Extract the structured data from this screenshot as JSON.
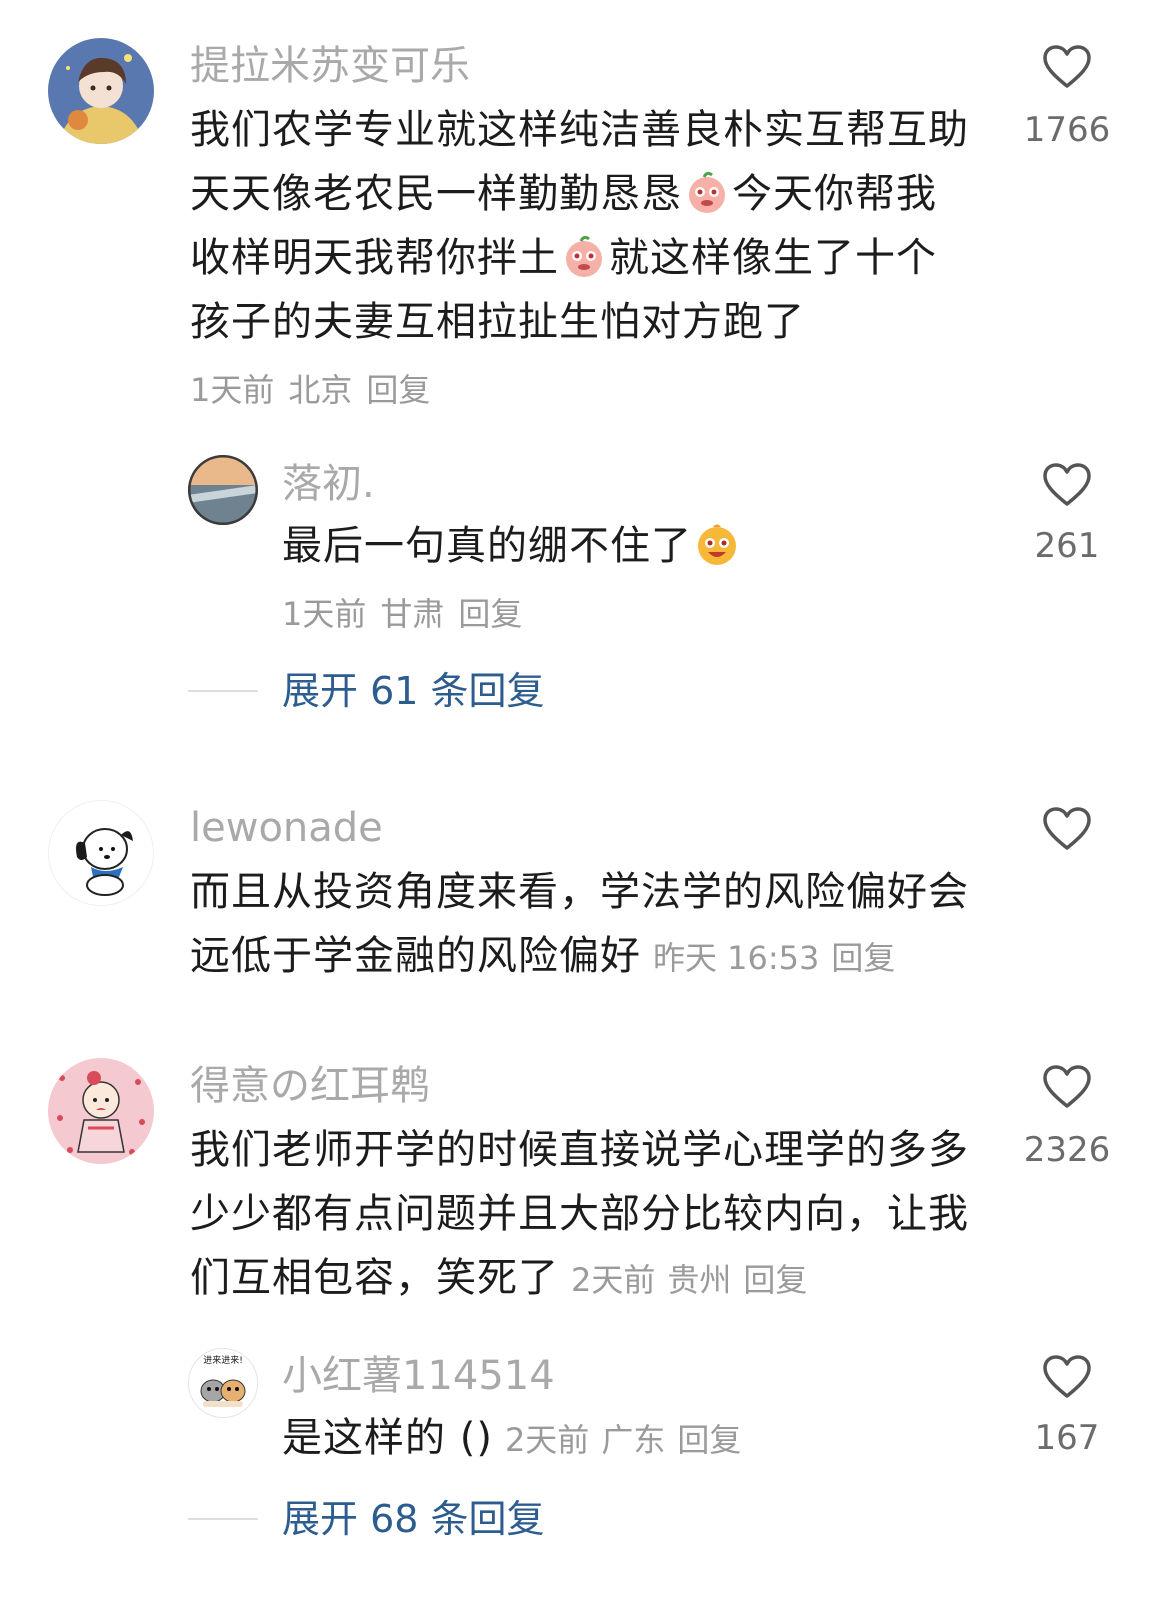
{
  "comments": [
    {
      "username": "提拉米苏变可乐",
      "lines": [
        "我们农学专业就这样纯洁善良朴实互帮互助",
        "天天像老农民一样勤勤恳恳",
        "今天你帮我",
        "收样明天我帮你拌土",
        "就这样像生了十个",
        "孩子的夫妻互相拉扯生怕对方跑了"
      ],
      "time": "1天前",
      "location": "北京",
      "reply_label": "回复",
      "likes": "1766",
      "replies": [
        {
          "username": "落初.",
          "text": "最后一句真的绷不住了",
          "time": "1天前",
          "location": "甘肃",
          "reply_label": "回复",
          "likes": "261"
        }
      ],
      "expand_label": "展开 61 条回复"
    },
    {
      "username": "lewonade",
      "lines": [
        "而且从投资角度来看，学法学的风险偏好会",
        "远低于学金融的风险偏好"
      ],
      "time": "昨天 16:53",
      "reply_label": "回复",
      "likes": ""
    },
    {
      "username": "得意の红耳鹎",
      "lines": [
        "我们老师开学的时候直接说学心理学的多多",
        "少少都有点问题并且大部分比较内向，让我",
        "们互相包容，笑死了"
      ],
      "time": "2天前",
      "location": "贵州",
      "reply_label": "回复",
      "likes": "2326",
      "replies": [
        {
          "username": "小红薯114514",
          "avatar_text": "进来进来!",
          "text": "是这样的 ()",
          "time": "2天前",
          "location": "广东",
          "reply_label": "回复",
          "likes": "167"
        }
      ],
      "expand_label": "展开 68 条回复"
    }
  ],
  "icons": {
    "like": "heart-outline-icon",
    "emoji_crying": "crying-peach-emoji",
    "emoji_laugh": "laughing-emoji"
  },
  "colors": {
    "username": "#a9a9a9",
    "body": "#1c1c1c",
    "meta": "#9a9a9a",
    "expand": "#2d5c8f",
    "heart": "#555555"
  }
}
